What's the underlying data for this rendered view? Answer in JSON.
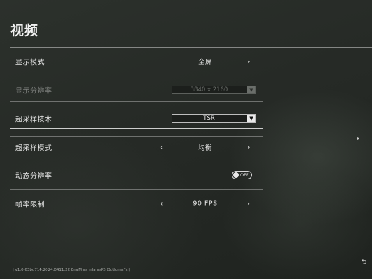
{
  "header": {
    "title": "视频"
  },
  "settings": [
    {
      "label": "显示模式",
      "value": "全屏"
    },
    {
      "label": "显示分辨率",
      "value": "3840 x 2160"
    },
    {
      "label": "超采样技术",
      "value": "TSR"
    },
    {
      "label": "超采样模式",
      "value": "均衡"
    },
    {
      "label": "动态分辨率",
      "value": "OFF"
    },
    {
      "label": "帧率限制",
      "value": "90 FPS"
    }
  ],
  "icons": {
    "arrow_left": "‹",
    "arrow_right": "›",
    "dropdown": "▼",
    "side": "▸",
    "back": "⮌"
  },
  "footer": {
    "text": "| v1.0.63bd714.2024.0411.22  EngMins  InlamsPS  OutlomsFs |"
  }
}
